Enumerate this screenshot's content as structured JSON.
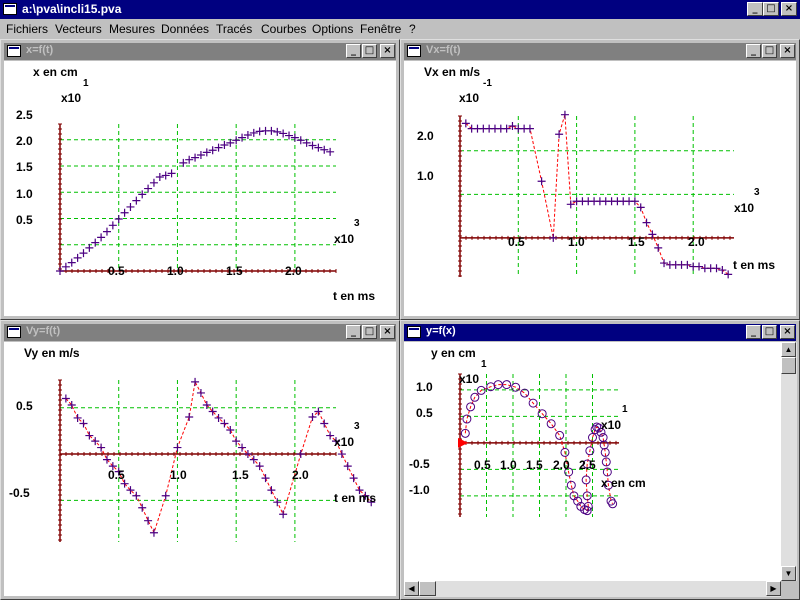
{
  "app": {
    "title": "a:\\pva\\incli15.pva",
    "minimize": "_",
    "maximize": "□",
    "close": "×"
  },
  "menu": [
    {
      "label": "Fichiers"
    },
    {
      "label": "Vecteurs"
    },
    {
      "label": "Mesures"
    },
    {
      "label": "Données"
    },
    {
      "label": "Tracés"
    },
    {
      "label": "Courbes"
    },
    {
      "label": "Options"
    },
    {
      "label": "Fenêtre"
    },
    {
      "label": "?"
    }
  ],
  "windows": {
    "xt": {
      "title": "x=f(t)",
      "ylabel": "x en cm",
      "yexp": "x10",
      "yexp_power": "1",
      "xlabel": "t en ms",
      "xexp": "x10",
      "xexp_power": "3"
    },
    "vxt": {
      "title": "Vx=f(t)",
      "ylabel": "Vx en m/s",
      "yexp": "x10",
      "yexp_power": "-1",
      "xlabel": "t en ms",
      "xexp": "x10",
      "xexp_power": "3"
    },
    "vyt": {
      "title": "Vy=f(t)",
      "ylabel": "Vy en m/s",
      "xlabel": "t en ms",
      "xexp": "x10",
      "xexp_power": "3"
    },
    "yx": {
      "title": "y=f(x)",
      "ylabel": "y en cm",
      "yexp": "x10",
      "yexp_power": "1",
      "xlabel": "x en cm",
      "xexp": "x10",
      "xexp_power": "1"
    }
  },
  "colors": {
    "marker": "#4b0082",
    "curve": "#ff0000",
    "grid": "#00c000",
    "axis": "#800000",
    "active_title": "#000080",
    "inactive_title": "#808080"
  },
  "chart_data": [
    {
      "type": "scatter",
      "title": "x=f(t)",
      "xlabel": "t en ms",
      "ylabel": "x en cm",
      "x_ticks": [
        "0.5",
        "1.0",
        "1.5",
        "2.0"
      ],
      "y_ticks": [
        "0.5",
        "1.0",
        "1.5",
        "2.0",
        "2.5"
      ],
      "x_scale": "x10^3",
      "y_scale": "x10^1",
      "xlim": [
        0,
        0.235
      ],
      "ylim": [
        0,
        2.8
      ],
      "grid": true,
      "marker": "+",
      "points": [
        [
          0.0,
          0.0
        ],
        [
          0.005,
          0.08
        ],
        [
          0.01,
          0.16
        ],
        [
          0.015,
          0.25
        ],
        [
          0.02,
          0.34
        ],
        [
          0.025,
          0.44
        ],
        [
          0.03,
          0.54
        ],
        [
          0.035,
          0.64
        ],
        [
          0.04,
          0.75
        ],
        [
          0.045,
          0.87
        ],
        [
          0.05,
          0.99
        ],
        [
          0.055,
          1.11
        ],
        [
          0.06,
          1.22
        ],
        [
          0.065,
          1.34
        ],
        [
          0.07,
          1.46
        ],
        [
          0.075,
          1.57
        ],
        [
          0.08,
          1.68
        ],
        [
          0.085,
          1.79
        ],
        [
          0.09,
          1.82
        ],
        [
          0.095,
          1.86
        ],
        [
          0.105,
          2.06
        ],
        [
          0.11,
          2.12
        ],
        [
          0.115,
          2.16
        ],
        [
          0.12,
          2.21
        ],
        [
          0.125,
          2.26
        ],
        [
          0.13,
          2.3
        ],
        [
          0.135,
          2.35
        ],
        [
          0.14,
          2.4
        ],
        [
          0.145,
          2.44
        ],
        [
          0.15,
          2.49
        ],
        [
          0.155,
          2.54
        ],
        [
          0.16,
          2.59
        ],
        [
          0.165,
          2.63
        ],
        [
          0.17,
          2.66
        ],
        [
          0.175,
          2.67
        ],
        [
          0.18,
          2.67
        ],
        [
          0.185,
          2.65
        ],
        [
          0.19,
          2.62
        ],
        [
          0.195,
          2.58
        ],
        [
          0.2,
          2.54
        ],
        [
          0.205,
          2.49
        ],
        [
          0.21,
          2.44
        ],
        [
          0.215,
          2.39
        ],
        [
          0.22,
          2.35
        ],
        [
          0.225,
          2.31
        ],
        [
          0.23,
          2.27
        ]
      ]
    },
    {
      "type": "scatter",
      "title": "Vx=f(t)",
      "xlabel": "t en ms",
      "ylabel": "Vx en m/s",
      "x_ticks": [
        "0.5",
        "1.0",
        "1.5",
        "2.0"
      ],
      "y_ticks": [
        "1.0",
        "2.0"
      ],
      "x_scale": "x10^3",
      "y_scale": "x10^-1",
      "xlim": [
        0,
        0.235
      ],
      "ylim": [
        -0.9,
        2.8
      ],
      "grid": true,
      "marker": "+",
      "connected_by_dashed_curve": true,
      "points": [
        [
          0.005,
          2.63
        ],
        [
          0.01,
          2.51
        ],
        [
          0.015,
          2.51
        ],
        [
          0.02,
          2.51
        ],
        [
          0.025,
          2.51
        ],
        [
          0.03,
          2.51
        ],
        [
          0.035,
          2.51
        ],
        [
          0.04,
          2.51
        ],
        [
          0.045,
          2.57
        ],
        [
          0.05,
          2.51
        ],
        [
          0.055,
          2.51
        ],
        [
          0.06,
          2.51
        ],
        [
          0.07,
          1.3
        ],
        [
          0.08,
          0.0
        ],
        [
          0.085,
          2.38
        ],
        [
          0.09,
          2.83
        ],
        [
          0.095,
          0.77
        ],
        [
          0.1,
          0.84
        ],
        [
          0.105,
          0.84
        ],
        [
          0.11,
          0.84
        ],
        [
          0.115,
          0.84
        ],
        [
          0.12,
          0.84
        ],
        [
          0.125,
          0.84
        ],
        [
          0.13,
          0.84
        ],
        [
          0.135,
          0.84
        ],
        [
          0.14,
          0.84
        ],
        [
          0.145,
          0.84
        ],
        [
          0.15,
          0.84
        ],
        [
          0.155,
          0.7
        ],
        [
          0.16,
          0.35
        ],
        [
          0.165,
          0.08
        ],
        [
          0.17,
          -0.23
        ],
        [
          0.175,
          -0.58
        ],
        [
          0.18,
          -0.62
        ],
        [
          0.185,
          -0.62
        ],
        [
          0.19,
          -0.62
        ],
        [
          0.195,
          -0.62
        ],
        [
          0.2,
          -0.66
        ],
        [
          0.205,
          -0.66
        ],
        [
          0.21,
          -0.7
        ],
        [
          0.215,
          -0.7
        ],
        [
          0.22,
          -0.7
        ],
        [
          0.225,
          -0.74
        ],
        [
          0.23,
          -0.84
        ]
      ]
    },
    {
      "type": "scatter",
      "title": "Vy=f(t)",
      "xlabel": "t en ms",
      "ylabel": "Vy en m/s",
      "x_ticks": [
        "0.5",
        "1.0",
        "1.5",
        "2.0"
      ],
      "y_ticks": [
        "0.5",
        "-0.5"
      ],
      "x_scale": "x10^3",
      "xlim": [
        0,
        0.235
      ],
      "ylim": [
        -0.95,
        0.8
      ],
      "grid": true,
      "marker": "+",
      "connected_by_dashed_curve": true,
      "points": [
        [
          0.005,
          0.6
        ],
        [
          0.01,
          0.53
        ],
        [
          0.015,
          0.39
        ],
        [
          0.02,
          0.33
        ],
        [
          0.025,
          0.2
        ],
        [
          0.03,
          0.14
        ],
        [
          0.035,
          0.07
        ],
        [
          0.04,
          -0.06
        ],
        [
          0.045,
          -0.13
        ],
        [
          0.05,
          -0.19
        ],
        [
          0.055,
          -0.32
        ],
        [
          0.06,
          -0.39
        ],
        [
          0.065,
          -0.45
        ],
        [
          0.07,
          -0.58
        ],
        [
          0.075,
          -0.72
        ],
        [
          0.08,
          -0.85
        ],
        [
          0.09,
          -0.45
        ],
        [
          0.1,
          0.07
        ],
        [
          0.11,
          0.4
        ],
        [
          0.115,
          0.78
        ],
        [
          0.12,
          0.66
        ],
        [
          0.125,
          0.53
        ],
        [
          0.13,
          0.46
        ],
        [
          0.135,
          0.39
        ],
        [
          0.14,
          0.33
        ],
        [
          0.145,
          0.26
        ],
        [
          0.15,
          0.14
        ],
        [
          0.155,
          0.07
        ],
        [
          0.16,
          0.0
        ],
        [
          0.165,
          -0.06
        ],
        [
          0.17,
          -0.13
        ],
        [
          0.175,
          -0.26
        ],
        [
          0.18,
          -0.39
        ],
        [
          0.185,
          -0.52
        ],
        [
          0.19,
          -0.65
        ],
        [
          0.205,
          0.0
        ],
        [
          0.215,
          0.4
        ],
        [
          0.22,
          0.46
        ],
        [
          0.225,
          0.33
        ],
        [
          0.23,
          0.2
        ],
        [
          0.235,
          0.14
        ],
        [
          0.24,
          0.0
        ],
        [
          0.245,
          -0.13
        ],
        [
          0.25,
          -0.26
        ],
        [
          0.255,
          -0.39
        ],
        [
          0.26,
          -0.45
        ],
        [
          0.265,
          -0.52
        ]
      ]
    },
    {
      "type": "scatter",
      "title": "y=f(x)",
      "xlabel": "x en cm",
      "ylabel": "y en cm",
      "x_ticks": [
        "0.5",
        "1.0",
        "1.5",
        "2.0",
        "2.5"
      ],
      "y_ticks": [
        "1.0",
        "0.5",
        "-0.5",
        "-1.0"
      ],
      "x_scale": "x10^1",
      "y_scale": "x10^1",
      "xlim": [
        0,
        3.0
      ],
      "ylim": [
        -1.4,
        1.3
      ],
      "grid": true,
      "marker": "o",
      "connected_by_dashed_curve": true,
      "points": [
        [
          0.1,
          0.18
        ],
        [
          0.13,
          0.45
        ],
        [
          0.2,
          0.68
        ],
        [
          0.28,
          0.86
        ],
        [
          0.4,
          0.99
        ],
        [
          0.58,
          1.06
        ],
        [
          0.72,
          1.1
        ],
        [
          0.88,
          1.1
        ],
        [
          1.05,
          1.05
        ],
        [
          1.22,
          0.94
        ],
        [
          1.38,
          0.75
        ],
        [
          1.55,
          0.55
        ],
        [
          1.72,
          0.36
        ],
        [
          1.88,
          0.14
        ],
        [
          1.98,
          -0.18
        ],
        [
          2.05,
          -0.55
        ],
        [
          2.1,
          -0.8
        ],
        [
          2.15,
          -1.0
        ],
        [
          2.22,
          -1.1
        ],
        [
          2.28,
          -1.2
        ],
        [
          2.35,
          -1.26
        ],
        [
          2.4,
          -1.28
        ],
        [
          2.42,
          -1.2
        ],
        [
          2.4,
          -1.0
        ],
        [
          2.38,
          -0.7
        ],
        [
          2.4,
          -0.4
        ],
        [
          2.45,
          -0.15
        ],
        [
          2.5,
          0.1
        ],
        [
          2.55,
          0.25
        ],
        [
          2.58,
          0.3
        ],
        [
          2.62,
          0.28
        ],
        [
          2.66,
          0.2
        ],
        [
          2.7,
          0.1
        ],
        [
          2.72,
          -0.04
        ],
        [
          2.74,
          -0.18
        ],
        [
          2.76,
          -0.36
        ],
        [
          2.78,
          -0.55
        ],
        [
          2.8,
          -0.8
        ],
        [
          2.85,
          -1.1
        ],
        [
          2.88,
          -1.15
        ]
      ]
    }
  ]
}
